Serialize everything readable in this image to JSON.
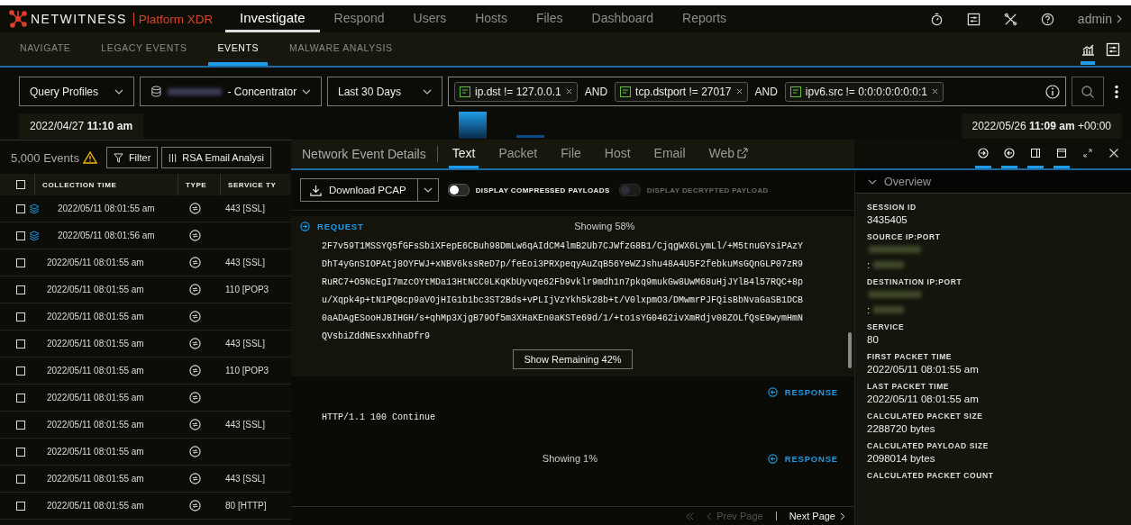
{
  "brand": {
    "name": "NETWITNESS",
    "product": "Platform XDR"
  },
  "nav": [
    {
      "label": "Investigate",
      "selected": true
    },
    {
      "label": "Respond",
      "selected": false
    },
    {
      "label": "Users",
      "selected": false
    },
    {
      "label": "Hosts",
      "selected": false
    },
    {
      "label": "Files",
      "selected": false
    },
    {
      "label": "Dashboard",
      "selected": false
    },
    {
      "label": "Reports",
      "selected": false
    }
  ],
  "user": "admin",
  "subnav": [
    {
      "label": "NAVIGATE",
      "selected": false
    },
    {
      "label": "LEGACY EVENTS",
      "selected": false
    },
    {
      "label": "EVENTS",
      "selected": true
    },
    {
      "label": "MALWARE ANALYSIS",
      "selected": false
    }
  ],
  "view_icons": [
    {
      "kind": "chart",
      "selected": true
    },
    {
      "kind": "settings",
      "selected": false
    }
  ],
  "query": {
    "profiles": "Query Profiles",
    "service": "- Concentrator",
    "range": "Last 30 Days",
    "filters": [
      {
        "text": "ip.dst != 127.0.0.1"
      },
      {
        "text": "tcp.dstport != 27017",
        "operator": "AND"
      },
      {
        "text": "ipv6.src != 0:0:0:0:0:0:0:1",
        "operator": "AND"
      }
    ]
  },
  "timeline": {
    "start_date": "2022/04/27",
    "start_time": "11:10 am",
    "end_date": "2022/05/26",
    "end_time": "11:09 am",
    "end_zone": "+00:00"
  },
  "events": {
    "count": "5,000 Events",
    "filter": "Filter",
    "column_group": "RSA Email Analysi",
    "all_checked": false,
    "columns": [
      "COLLECTION TIME",
      "TYPE",
      "SERVICE TY"
    ],
    "rows": [
      {
        "time": "2022/05/11 08:01:55 am",
        "service": "443 [SSL]",
        "grouped": true,
        "checked": false
      },
      {
        "time": "2022/05/11 08:01:56 am",
        "grouped": true,
        "checked": false
      },
      {
        "time": "2022/05/11 08:01:55 am",
        "service": "443 [SSL]",
        "grouped": false,
        "checked": false
      },
      {
        "time": "2022/05/11 08:01:55 am",
        "service": "110 [POP3",
        "grouped": false,
        "checked": false
      },
      {
        "time": "2022/05/11 08:01:55 am",
        "grouped": false,
        "checked": false
      },
      {
        "time": "2022/05/11 08:01:55 am",
        "service": "443 [SSL]",
        "grouped": false,
        "checked": false
      },
      {
        "time": "2022/05/11 08:01:55 am",
        "service": "110 [POP3",
        "grouped": false,
        "checked": false
      },
      {
        "time": "2022/05/11 08:01:55 am",
        "grouped": false,
        "checked": false
      },
      {
        "time": "2022/05/11 08:01:55 am",
        "service": "443 [SSL]",
        "grouped": false,
        "checked": false
      },
      {
        "time": "2022/05/11 08:01:55 am",
        "grouped": false,
        "checked": false
      },
      {
        "time": "2022/05/11 08:01:55 am",
        "service": "443 [SSL]",
        "grouped": false,
        "checked": false
      },
      {
        "time": "2022/05/11 08:01:55 am",
        "service": "80 [HTTP]",
        "grouped": false,
        "checked": false
      }
    ]
  },
  "details": {
    "title": "Network Event Details",
    "tabs": [
      {
        "label": "Text",
        "selected": true,
        "external": false
      },
      {
        "label": "Packet",
        "selected": false,
        "external": false
      },
      {
        "label": "File",
        "selected": false,
        "external": false
      },
      {
        "label": "Host",
        "selected": false,
        "external": false
      },
      {
        "label": "Email",
        "selected": false,
        "external": false
      },
      {
        "label": "Web",
        "selected": false,
        "external": true
      }
    ],
    "tools": [
      {
        "kind": "request",
        "selected": true
      },
      {
        "kind": "response",
        "selected": true
      },
      {
        "kind": "sidebar",
        "selected": true
      },
      {
        "kind": "layout",
        "selected": true
      },
      {
        "kind": "expand",
        "selected": false
      },
      {
        "kind": "close",
        "selected": false
      }
    ],
    "download": "Download PCAP",
    "toggles": [
      {
        "label": "DISPLAY COMPRESSED PAYLOADS",
        "on": false,
        "disabled": false
      },
      {
        "label": "DISPLAY DECRYPTED PAYLOAD",
        "on": false,
        "disabled": true
      }
    ],
    "blocks": [
      {
        "kind": "request",
        "label": "REQUEST",
        "showing": "Showing 58%",
        "lines": [
          "2F7v59T1MSSYQ5fGFsSbiXFepE6CBuh98DmLw6qAIdCM4lmB2Ub7CJWfzG8B1/CjqgWX6LymLl/+M5tnuGYsiPAzY",
          "DhT4yGnSIOPAtj8OYFWJ+xNBV6kssReD7p/feEoi3PRXpeqyAuZqB56YeWZJshu48A4U5F2febkuMsGQnGLP07zR9",
          "RuRC7+O5NcEgI7mzcOYtMDa13HtNCC0LKqKbUyvqe62Fb9vklr9mdh1n7pkq9mukGw8UwM68uHjJYlB4l57RQC+8p",
          "u/Xqpk4p+tN1PQBcp9aVOjHIG1b1bc3ST2Bds+vPLIjVzYkh5k28b+t/V0lxpmO3/DMwmrPJFQisBbNvaGaSB1DCB",
          "0aADAgESooHJBIHGH/s+qhMp3XjgB79Of5m3XHaKEn0aKSTe69d/1/+to1sYG0462ivXmRdjv08ZOLfQsE9wymHmN",
          "QVsbiZddNEsxxhhaDfr9"
        ],
        "button": "Show Remaining 42%"
      },
      {
        "kind": "response",
        "label": "RESPONSE",
        "lines": [
          "HTTP/1.1 100 Continue"
        ]
      },
      {
        "kind": "response",
        "label": "RESPONSE",
        "showing": "Showing 1%"
      }
    ],
    "pager": {
      "prev": "Prev Page",
      "next": "Next Page"
    }
  },
  "overview": {
    "title": "Overview",
    "fields": [
      {
        "kind": "text",
        "label": "SESSION ID",
        "values": [
          "3435405"
        ]
      },
      {
        "kind": "redacted",
        "label": "SOURCE IP:PORT",
        "values": [
          ":"
        ]
      },
      {
        "kind": "redacted",
        "label": "DESTINATION IP:PORT",
        "values": [
          ":"
        ]
      },
      {
        "kind": "text",
        "label": "SERVICE",
        "values": [
          "80"
        ]
      },
      {
        "kind": "text",
        "label": "FIRST PACKET TIME",
        "values": [
          "2022/05/11 08:01:55 am"
        ]
      },
      {
        "kind": "text",
        "label": "LAST PACKET TIME",
        "values": [
          "2022/05/11 08:01:55 am"
        ]
      },
      {
        "kind": "text",
        "label": "CALCULATED PACKET SIZE",
        "values": [
          "2288720 bytes"
        ]
      },
      {
        "kind": "text",
        "label": "CALCULATED PAYLOAD SIZE",
        "values": [
          "2098014 bytes"
        ]
      },
      {
        "kind": "text",
        "label": "CALCULATED PACKET COUNT"
      }
    ]
  }
}
